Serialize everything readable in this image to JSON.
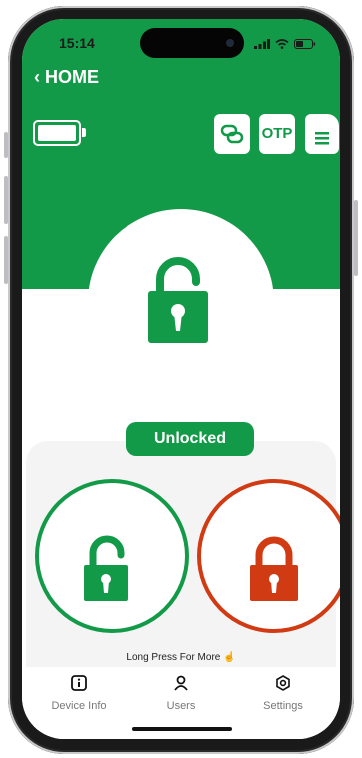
{
  "status_bar": {
    "time": "15:14"
  },
  "header": {
    "back_label": "HOME",
    "otp_label": "OTP"
  },
  "lock": {
    "status_label": "Unlocked"
  },
  "hint": {
    "text": "Long Press For More"
  },
  "tabs": [
    {
      "label": "Device Info",
      "icon": "info-icon"
    },
    {
      "label": "Users",
      "icon": "user-icon"
    },
    {
      "label": "Settings",
      "icon": "settings-icon"
    }
  ],
  "colors": {
    "brand_green": "#139a48",
    "lock_red": "#d13b14"
  },
  "battery_level": 1.0
}
